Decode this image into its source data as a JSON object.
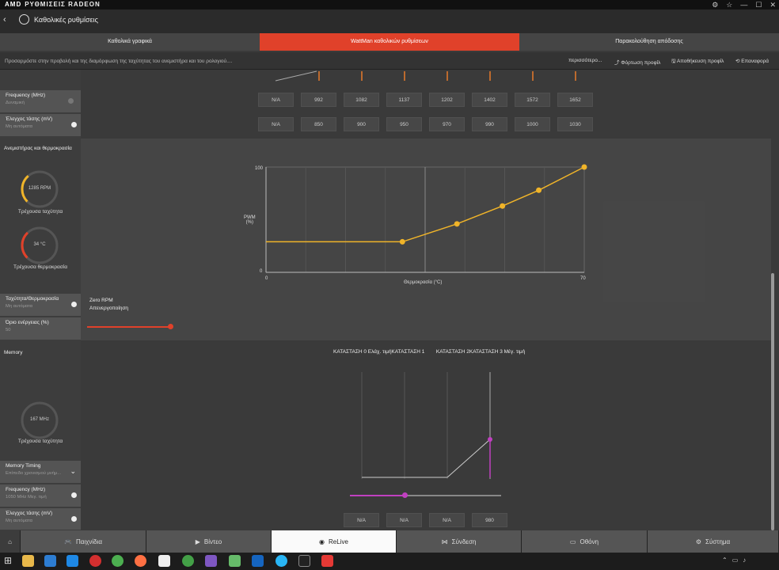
{
  "titlebar": {
    "brand": "AMD",
    "app": "ΡΥΘΜΙΣΕΙΣ RADEON"
  },
  "header": {
    "title": "Καθολικές ρυθμίσεις"
  },
  "tabs": [
    "Καθολικά γραφικά",
    "WattMan καθολικών ρυθμίσεων",
    "Παρακολούθηση απόδοσης"
  ],
  "toolbar": {
    "description": "Προσαρμόστε στην προβολή και της διαμόρφωση της ταχύτητας του ανεμιστήρα και του ρολογιού....",
    "more": "περισσότερο...",
    "load": "Φόρτωση προφίλ",
    "save": "Αποθήκευση προφίλ",
    "reset": "Επαναφορά"
  },
  "sidebar": {
    "freq": {
      "label": "Frequency (MHz)",
      "value": "Δυναμική"
    },
    "volt": {
      "label": "Έλεγχος τάσης (mV)",
      "value": "Μη αυτόματα"
    },
    "fan_section": "Ανεμιστήρας και θερμοκρασία",
    "gauge_rpm": {
      "value": "1285 RPM",
      "label": "Τρέχουσα ταχύτητα",
      "fraction": 0.35
    },
    "gauge_temp": {
      "value": "34 °C",
      "label": "Τρέχουσα θερμοκρασία",
      "fraction": 0.34
    },
    "fan_temp": {
      "label": "Ταχύτητα/Θερμοκρασία",
      "value": "Μη αυτόματα"
    },
    "power": {
      "label": "Όριο ενέργειας (%)",
      "value": "50"
    },
    "memory_section": "Memory",
    "gauge_mem": {
      "value": "167 MHz",
      "label": "Τρέχουσα ταχύτητα"
    },
    "timing": {
      "label": "Memory Timing",
      "value": "Επίπεδο χρονισμού μνήμ..."
    },
    "mem_freq": {
      "label": "Frequency (MHz)",
      "value": "1050 MHz Μεγ. τιμή"
    },
    "mem_volt": {
      "label": "Έλεγχος τάσης (mV)",
      "value": "Μη αυτόματα"
    }
  },
  "gpu_table": {
    "freq": [
      "N/A",
      "992",
      "1082",
      "1137",
      "1202",
      "1402",
      "1572",
      "1652"
    ],
    "volt": [
      "N/A",
      "850",
      "900",
      "950",
      "970",
      "990",
      "1000",
      "1030"
    ]
  },
  "zero_rpm": {
    "label": "Zero RPM",
    "value": "Απενεργοποίηση"
  },
  "fan_chart": {
    "ylabel": "PWM\n(%)",
    "xlabel": "Θερμοκρασία (°C)",
    "ymax": "100",
    "ymin": "0",
    "xmin": "0",
    "xmax": "70"
  },
  "chart_data": {
    "type": "line",
    "x": [
      0,
      30,
      42,
      52,
      60,
      70
    ],
    "y": [
      29,
      29,
      46,
      63,
      78,
      100
    ],
    "xlim": [
      0,
      70
    ],
    "ylim": [
      0,
      100
    ],
    "xlabel": "Θερμοκρασία (°C)",
    "ylabel": "PWM (%)",
    "color": "#f0b429"
  },
  "mem_states": {
    "header": "ΚΑΤΑΣΤΑΣΗ 0 Ελάχ. τιμήΚΑΤΑΣΤΑΣΗ 1        ΚΑΤΑΣΤΑΣΗ 2ΚΑΤΑΣΤΑΣΗ 3 Μέγ. τιμή",
    "values": [
      "N/A",
      "N/A",
      "N/A",
      "980"
    ]
  },
  "bottom_tabs": [
    "Παιχνίδια",
    "Βίντεο",
    "ReLive",
    "Σύνδεση",
    "Οθόνη",
    "Σύστημα"
  ],
  "icons": [
    "amd-logo",
    "globe-icon",
    "back-arrow-icon",
    "gamepad-icon",
    "play-icon",
    "relive-icon",
    "share-icon",
    "monitor-icon",
    "system-icon",
    "windows-start-icon"
  ]
}
